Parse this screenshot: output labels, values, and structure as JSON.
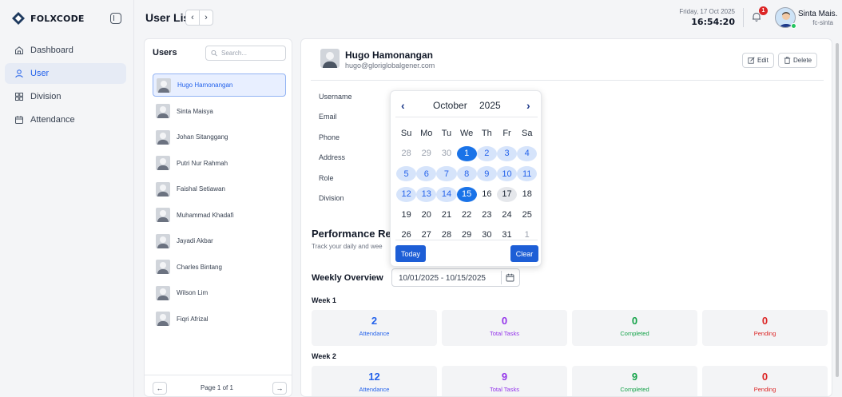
{
  "sidebar": {
    "logo_text": "FOLXCODE",
    "items": [
      {
        "label": "Dashboard",
        "icon": "home-icon"
      },
      {
        "label": "User",
        "icon": "user-icon"
      },
      {
        "label": "Division",
        "icon": "grid-icon"
      },
      {
        "label": "Attendance",
        "icon": "calendar-icon"
      }
    ],
    "active_index": 1
  },
  "header": {
    "title": "User List",
    "back": "‹",
    "forward": "›",
    "date": "Friday, 17 Oct 2025",
    "time": "16:54:20",
    "notification_count": "1",
    "user_name": "Sinta Mais...",
    "user_handle": "fc-sinta"
  },
  "users": {
    "title": "Users",
    "search_placeholder": "Search...",
    "list": [
      "Hugo Hamonangan",
      "Sinta Maisya",
      "Johan Sitanggang",
      "Putri Nur Rahmah",
      "Faishal Setiawan",
      "Muhammad Khadafi",
      "Jayadi Akbar",
      "Charles Bintang",
      "Wilson Lim",
      "Fiqri Afrizal"
    ],
    "active_index": 0,
    "pager_prev": "←",
    "pager_next": "→",
    "pager_text": "Page 1 of 1"
  },
  "detail": {
    "name": "Hugo Hamonangan",
    "email": "hugo@gloriglobalgener.com",
    "edit_label": "Edit",
    "delete_label": "Delete",
    "fields": [
      "Username",
      "Email",
      "Phone",
      "Address",
      "Role",
      "Division"
    ],
    "perf_title": "Performance Re",
    "perf_sub": "Track your daily and wee",
    "weekly_title": "Weekly Overview",
    "range_value": "10/01/2025 - 10/15/2025",
    "weeks": [
      {
        "label": "Week 1",
        "stats": [
          {
            "value": "2",
            "label": "Attendance",
            "color": "#2563eb"
          },
          {
            "value": "0",
            "label": "Total Tasks",
            "color": "#9333ea"
          },
          {
            "value": "0",
            "label": "Completed",
            "color": "#16a34a"
          },
          {
            "value": "0",
            "label": "Pending",
            "color": "#dc2626"
          }
        ]
      },
      {
        "label": "Week 2",
        "stats": [
          {
            "value": "12",
            "label": "Attendance",
            "color": "#2563eb"
          },
          {
            "value": "9",
            "label": "Total Tasks",
            "color": "#9333ea"
          },
          {
            "value": "9",
            "label": "Completed",
            "color": "#16a34a"
          },
          {
            "value": "0",
            "label": "Pending",
            "color": "#dc2626"
          }
        ]
      }
    ]
  },
  "calendar": {
    "prev": "‹",
    "next": "›",
    "month": "October",
    "year": "2025",
    "weekdays": [
      "Su",
      "Mo",
      "Tu",
      "We",
      "Th",
      "Fr",
      "Sa"
    ],
    "weeks": [
      [
        "28",
        "29",
        "30",
        "1",
        "2",
        "3",
        "4"
      ],
      [
        "5",
        "6",
        "7",
        "8",
        "9",
        "10",
        "11"
      ],
      [
        "12",
        "13",
        "14",
        "15",
        "16",
        "17",
        "18"
      ],
      [
        "19",
        "20",
        "21",
        "22",
        "23",
        "24",
        "25"
      ],
      [
        "26",
        "27",
        "28",
        "29",
        "30",
        "31",
        "1"
      ]
    ],
    "range_start": "1",
    "range_end": "15",
    "hover_day": "17",
    "today_label": "Today",
    "clear_label": "Clear"
  }
}
